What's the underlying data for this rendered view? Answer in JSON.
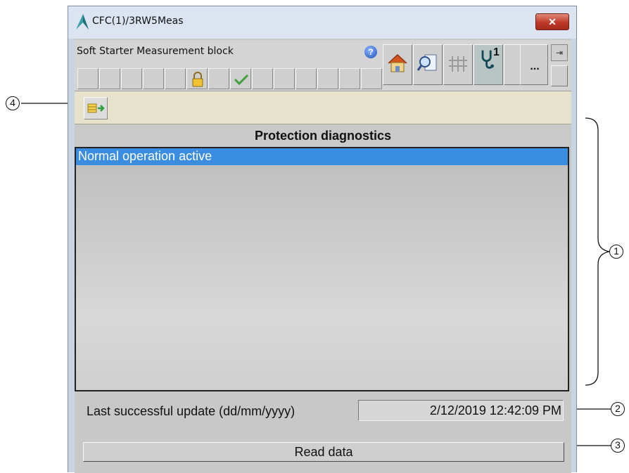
{
  "window": {
    "title": "CFC(1)/3RW5Meas",
    "close_label": "✕"
  },
  "header": {
    "block_title": "Soft Starter Measurement block",
    "help_label": "?",
    "more_label": "...",
    "pin_label": "⇥",
    "diagnostics_badge": "1"
  },
  "toolbar": {
    "buttons": [
      "return-to-faceplate"
    ]
  },
  "section": {
    "title": "Protection diagnostics"
  },
  "list": {
    "items": [
      "Normal operation active"
    ]
  },
  "status": {
    "update_label": "Last successful update (dd/mm/yyyy)",
    "update_value": "2/12/2019  12:42:09 PM"
  },
  "actions": {
    "read_label": "Read data"
  },
  "callouts": {
    "c1": "1",
    "c2": "2",
    "c3": "3",
    "c4": "4"
  },
  "colors": {
    "selection": "#3a8de0",
    "toolbar_bg": "#e7e2cc",
    "close": "#c0392b"
  }
}
